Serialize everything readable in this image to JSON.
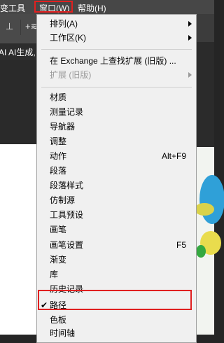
{
  "menubar": {
    "left_label": "渐变工具",
    "window_label": "窗口(W)",
    "help_label": "帮助(H)"
  },
  "left_panel": {
    "ai_text": "AI AI生成,"
  },
  "window_menu": {
    "items": [
      {
        "label": "排列(A)",
        "submenu": true
      },
      {
        "label": "工作区(K)",
        "submenu": true
      },
      {
        "label": "在 Exchange 上查找扩展 (旧版) ..."
      },
      {
        "label": "扩展 (旧版)",
        "submenu": true,
        "disabled": true
      },
      {
        "label": "材质"
      },
      {
        "label": "测量记录"
      },
      {
        "label": "导航器"
      },
      {
        "label": "调整"
      },
      {
        "label": "动作",
        "shortcut": "Alt+F9"
      },
      {
        "label": "段落"
      },
      {
        "label": "段落样式"
      },
      {
        "label": "仿制源"
      },
      {
        "label": "工具预设"
      },
      {
        "label": "画笔"
      },
      {
        "label": "画笔设置",
        "shortcut": "F5"
      },
      {
        "label": "渐变"
      },
      {
        "label": "库"
      },
      {
        "label": "历史记录"
      },
      {
        "label": "路径",
        "checked": true
      },
      {
        "label": "色板"
      },
      {
        "label": "时间轴"
      }
    ],
    "check_glyph": "✔"
  },
  "colors": {
    "highlight_border": "#e02020",
    "menu_bg": "#f0f0f0",
    "menubar_bg": "#474747"
  }
}
